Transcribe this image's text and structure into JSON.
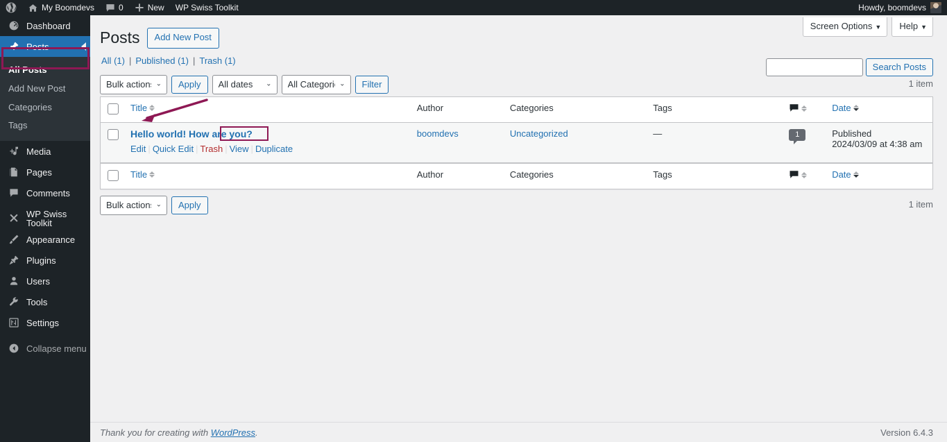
{
  "adminbar": {
    "wp_logo_icon": "wordpress-logo-icon",
    "site_icon": "home-icon",
    "site_name": "My Boomdevs",
    "comments_icon": "comment-bubble-icon",
    "comments_count": "0",
    "new_icon": "plus-icon",
    "new_label": "New",
    "toolkit_label": "WP Swiss Toolkit",
    "howdy": "Howdy, boomdevs",
    "avatar": "avatar"
  },
  "sidebar": {
    "items": [
      {
        "label": "Dashboard",
        "icon": "dashboard-icon",
        "key": "dashboard"
      },
      {
        "label": "Posts",
        "icon": "pin-icon",
        "key": "posts",
        "current": true
      },
      {
        "label": "Media",
        "icon": "media-icon",
        "key": "media"
      },
      {
        "label": "Pages",
        "icon": "pages-icon",
        "key": "pages"
      },
      {
        "label": "Comments",
        "icon": "comment-bubble-icon",
        "key": "comments"
      },
      {
        "label": "WP Swiss Toolkit",
        "icon": "tools-cross-icon",
        "key": "wp-swiss-toolkit"
      },
      {
        "label": "Appearance",
        "icon": "brush-icon",
        "key": "appearance"
      },
      {
        "label": "Plugins",
        "icon": "plug-icon",
        "key": "plugins"
      },
      {
        "label": "Users",
        "icon": "user-icon",
        "key": "users"
      },
      {
        "label": "Tools",
        "icon": "wrench-icon",
        "key": "tools"
      },
      {
        "label": "Settings",
        "icon": "sliders-icon",
        "key": "settings"
      }
    ],
    "submenu": [
      {
        "label": "All Posts",
        "current": true
      },
      {
        "label": "Add New Post",
        "current": false
      },
      {
        "label": "Categories",
        "current": false
      },
      {
        "label": "Tags",
        "current": false
      }
    ],
    "collapse": {
      "label": "Collapse menu",
      "icon": "collapse-arrow-icon"
    }
  },
  "screen_meta": {
    "screen_options": "Screen Options",
    "help": "Help",
    "caret": "▼"
  },
  "header": {
    "title": "Posts",
    "add_new": "Add New Post"
  },
  "views": {
    "all": "All",
    "all_count": "(1)",
    "published": "Published",
    "published_count": "(1)",
    "trash": "Trash",
    "trash_count": "(1)",
    "separator": "|"
  },
  "search": {
    "value": "",
    "placeholder": "",
    "button": "Search Posts"
  },
  "tablenav": {
    "bulk_actions": "Bulk actions",
    "apply": "Apply",
    "all_dates": "All dates",
    "all_categories": "All Categories",
    "filter": "Filter",
    "displaying_num_top": "1 item",
    "displaying_num_bottom": "1 item"
  },
  "table": {
    "columns": {
      "title": "Title",
      "author": "Author",
      "categories": "Categories",
      "tags": "Tags",
      "comments_icon": "comment-bubble-icon",
      "date": "Date"
    },
    "rows": [
      {
        "title": "Hello world! How are you?",
        "actions": {
          "edit": "Edit",
          "quick_edit": "Quick Edit",
          "trash": "Trash",
          "view": "View",
          "duplicate": "Duplicate"
        },
        "author": "boomdevs",
        "categories": "Uncategorized",
        "tags": "—",
        "comments": "1",
        "date_status": "Published",
        "date_value": "2024/03/09 at 4:38 am"
      }
    ]
  },
  "footer": {
    "thanks_prefix": "Thank you for creating with ",
    "wordpress": "WordPress",
    "thanks_suffix": ".",
    "version": "Version 6.4.3"
  },
  "annotations": {
    "color": "#8e1854",
    "posts_box": "highlight-box-posts",
    "duplicate_box": "highlight-box-duplicate",
    "arrow": "pointer-arrow-to-post-title"
  }
}
